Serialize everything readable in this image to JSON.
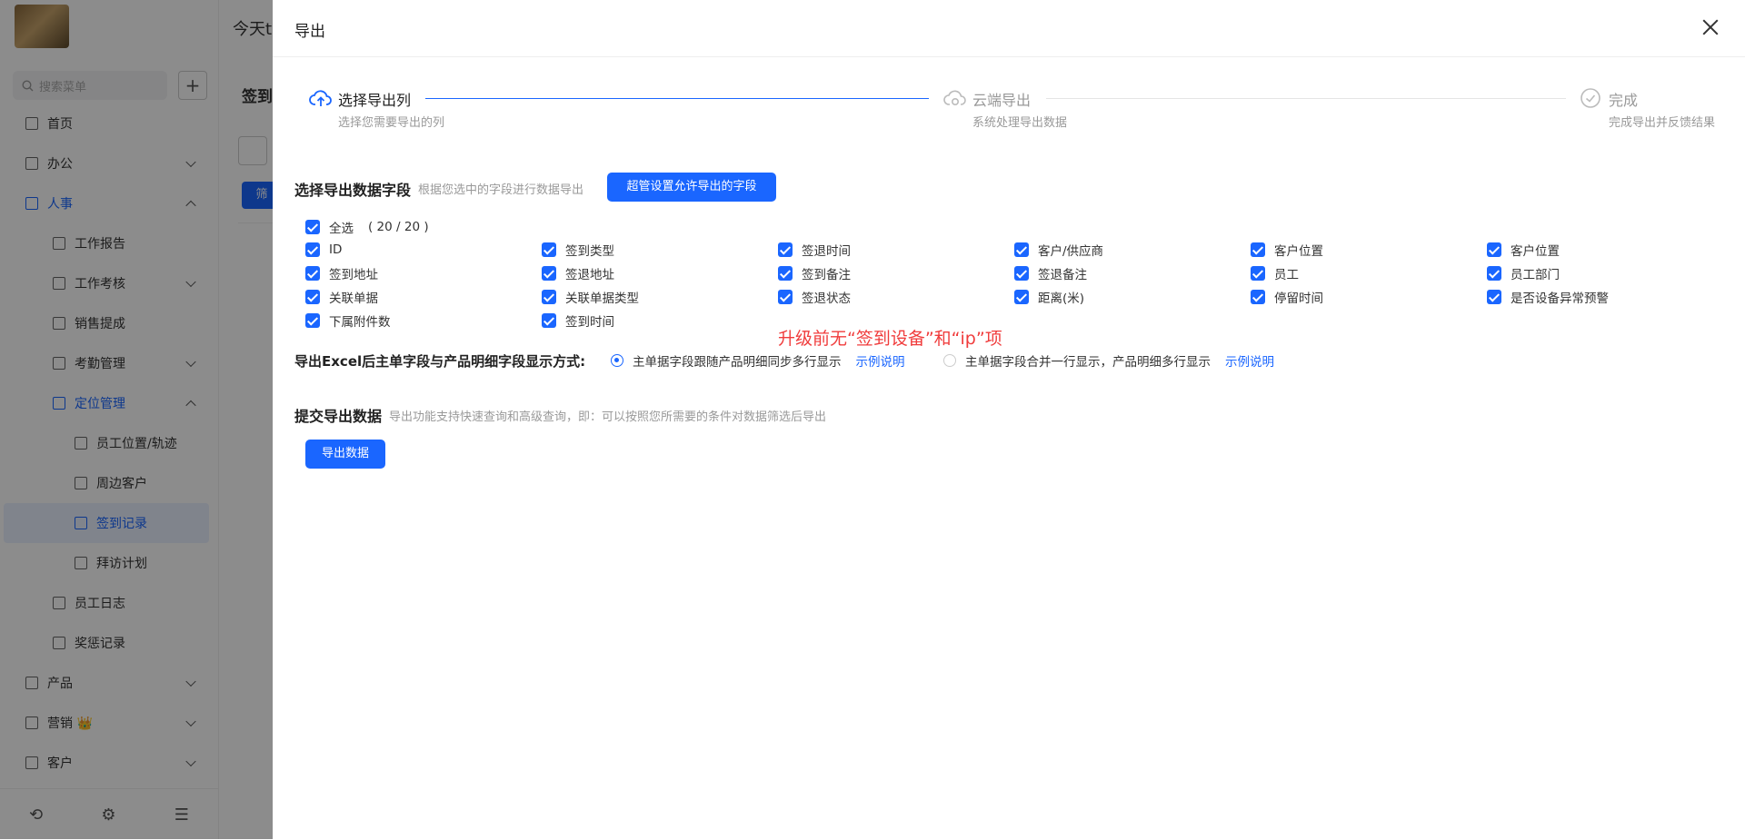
{
  "background": {
    "topbar_text": "今天t",
    "search_placeholder": "搜索菜单",
    "menu": [
      {
        "label": "首页",
        "indent": 0
      },
      {
        "label": "办公",
        "indent": 0,
        "arrow": "down"
      },
      {
        "label": "人事",
        "indent": 0,
        "arrow": "up",
        "active": true
      },
      {
        "label": "工作报告",
        "indent": 1
      },
      {
        "label": "工作考核",
        "indent": 1,
        "arrow": "down"
      },
      {
        "label": "销售提成",
        "indent": 1
      },
      {
        "label": "考勤管理",
        "indent": 1,
        "arrow": "down"
      },
      {
        "label": "定位管理",
        "indent": 1,
        "arrow": "up",
        "active": true
      },
      {
        "label": "员工位置/轨迹",
        "indent": 2
      },
      {
        "label": "周边客户",
        "indent": 2
      },
      {
        "label": "签到记录",
        "indent": 2,
        "selected": true
      },
      {
        "label": "拜访计划",
        "indent": 2
      },
      {
        "label": "员工日志",
        "indent": 1
      },
      {
        "label": "奖惩记录",
        "indent": 1
      },
      {
        "label": "产品",
        "indent": 0,
        "arrow": "down"
      },
      {
        "label": "营销 👑",
        "indent": 0,
        "arrow": "down"
      },
      {
        "label": "客户",
        "indent": 0,
        "arrow": "down"
      }
    ],
    "main_title": "签到",
    "main_button": "筛"
  },
  "drawer": {
    "title": "导出",
    "steps": [
      {
        "title": "选择导出列",
        "desc": "选择您需要导出的列",
        "state": "active"
      },
      {
        "title": "云端导出",
        "desc": "系统处理导出数据",
        "state": "wait"
      },
      {
        "title": "完成",
        "desc": "完成导出并反馈结果",
        "state": "wait"
      }
    ],
    "fields_section": {
      "title": "选择导出数据字段",
      "hint": "根据您选中的字段进行数据导出",
      "admin_button": "超管设置允许导出的字段",
      "select_all": "全选",
      "count": "( 20 / 20 )",
      "fields": [
        [
          "ID",
          "签到类型",
          "签退时间",
          "客户/供应商",
          "客户位置",
          "客户位置"
        ],
        [
          "签到地址",
          "签退地址",
          "签到备注",
          "签退备注",
          "员工",
          "员工部门"
        ],
        [
          "关联单据",
          "关联单据类型",
          "签退状态",
          "距离(米)",
          "停留时间",
          "是否设备异常预警"
        ],
        [
          "下属附件数",
          "签到时间"
        ]
      ]
    },
    "annotation": "升级前无“签到设备”和“ip”项",
    "display_mode": {
      "label": "导出Excel后主单字段与产品明细字段显示方式:",
      "options": [
        {
          "text": "主单据字段跟随产品明细同步多行显示",
          "link": "示例说明",
          "selected": true
        },
        {
          "text": "主单据字段合并一行显示，产品明细多行显示",
          "link": "示例说明",
          "selected": false
        }
      ]
    },
    "submit_section": {
      "title": "提交导出数据",
      "hint": "导出功能支持快速查询和高级查询，即：可以按照您所需要的条件对数据筛选后导出",
      "button": "导出数据"
    },
    "colors": {
      "primary": "#1a66ff",
      "annotation": "#f03c3c"
    }
  }
}
